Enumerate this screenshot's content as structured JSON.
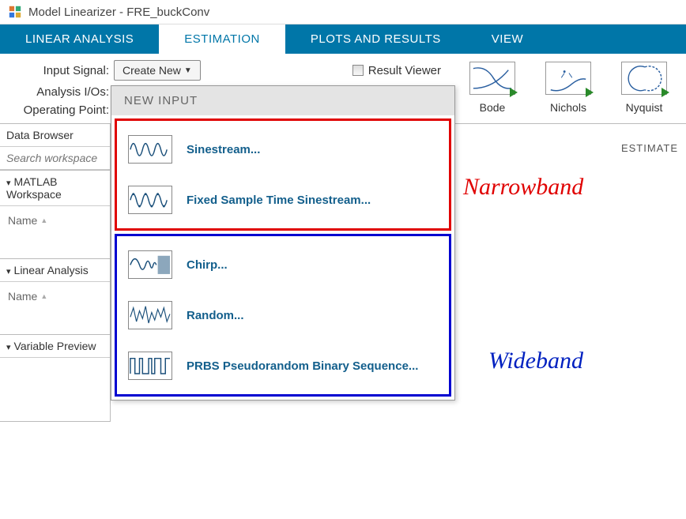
{
  "title": "Model Linearizer - FRE_buckConv",
  "tabs": [
    "LINEAR ANALYSIS",
    "ESTIMATION",
    "PLOTS AND RESULTS",
    "VIEW"
  ],
  "active_tab": "ESTIMATION",
  "toolbar": {
    "input_signal_label": "Input Signal:",
    "create_new": "Create New",
    "analysis_ios_label": "Analysis I/Os:",
    "operating_point_label": "Operating Point:",
    "result_viewer": "Result Viewer"
  },
  "plot_buttons": [
    "Bode",
    "Nichols",
    "Nyquist"
  ],
  "estimate_section": "ESTIMATE",
  "sidebar": {
    "data_browser": "Data Browser",
    "search_placeholder": "Search workspace",
    "matlab_ws": "MATLAB Workspace",
    "linear_analysis": "Linear Analysis",
    "variable_preview": "Variable Preview",
    "name_col": "Name"
  },
  "dropdown": {
    "header": "NEW INPUT",
    "narrowband": [
      "Sinestream...",
      "Fixed Sample Time Sinestream..."
    ],
    "wideband": [
      "Chirp...",
      "Random...",
      "PRBS Pseudorandom Binary Sequence..."
    ]
  },
  "annotations": {
    "narrowband": "Narrowband",
    "wideband": "Wideband"
  }
}
